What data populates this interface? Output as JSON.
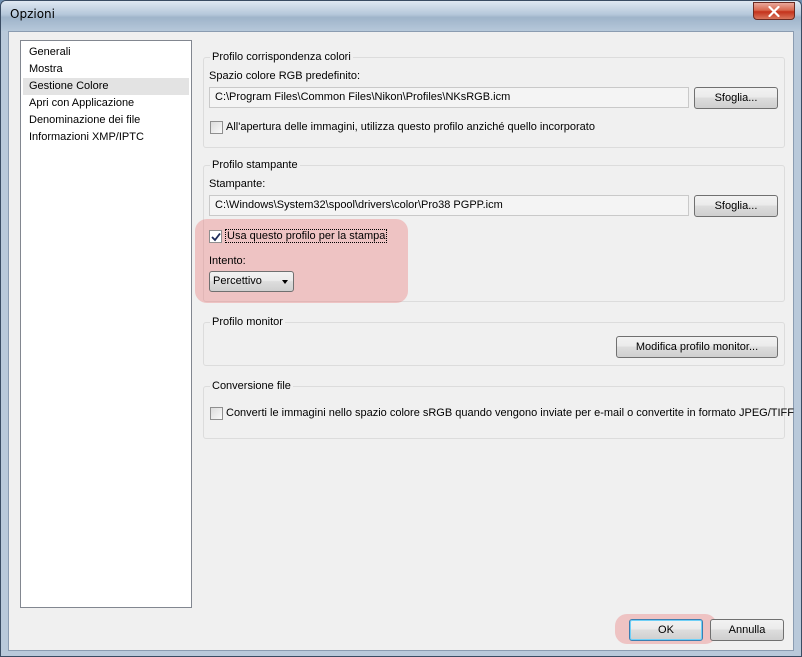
{
  "window": {
    "title": "Opzioni"
  },
  "sidebar": {
    "items": [
      {
        "label": "Generali",
        "selected": false
      },
      {
        "label": "Mostra",
        "selected": false
      },
      {
        "label": "Gestione Colore",
        "selected": true
      },
      {
        "label": "Apri con Applicazione",
        "selected": false
      },
      {
        "label": "Denominazione dei file",
        "selected": false
      },
      {
        "label": "Informazioni XMP/IPTC",
        "selected": false
      }
    ]
  },
  "color_profile": {
    "group_title": "Profilo corrispondenza colori",
    "rgb_label": "Spazio colore RGB predefinito:",
    "rgb_path": "C:\\Program Files\\Common Files\\Nikon\\Profiles\\NKsRGB.icm",
    "browse_label": "Sfoglia...",
    "embedded_checkbox_label": "All'apertura delle immagini, utilizza questo profilo anziché quello incorporato",
    "embedded_checked": false
  },
  "printer_profile": {
    "group_title": "Profilo stampante",
    "printer_label": "Stampante:",
    "printer_path": "C:\\Windows\\System32\\spool\\drivers\\color\\Pro38 PGPP.icm",
    "browse_label": "Sfoglia...",
    "use_checkbox_label": "Usa questo profilo per la stampa",
    "use_checked": true,
    "intent_label": "Intento:",
    "intent_value": "Percettivo"
  },
  "monitor_profile": {
    "group_title": "Profilo monitor",
    "edit_button": "Modifica profilo monitor..."
  },
  "conversion": {
    "group_title": "Conversione file",
    "checkbox_label": "Converti le immagini nello spazio colore sRGB quando vengono inviate per e-mail o convertite in formato JPEG/TIFF",
    "checked": false
  },
  "footer": {
    "ok_label": "OK",
    "cancel_label": "Annulla"
  },
  "colors": {
    "highlight": "#eb7878",
    "close_button": "#c4321b",
    "default_button_border": "#3c7fb1"
  },
  "icons": {
    "close": "close-icon",
    "dropdown": "chevron-down-icon",
    "checkmark": "checkmark-icon"
  }
}
